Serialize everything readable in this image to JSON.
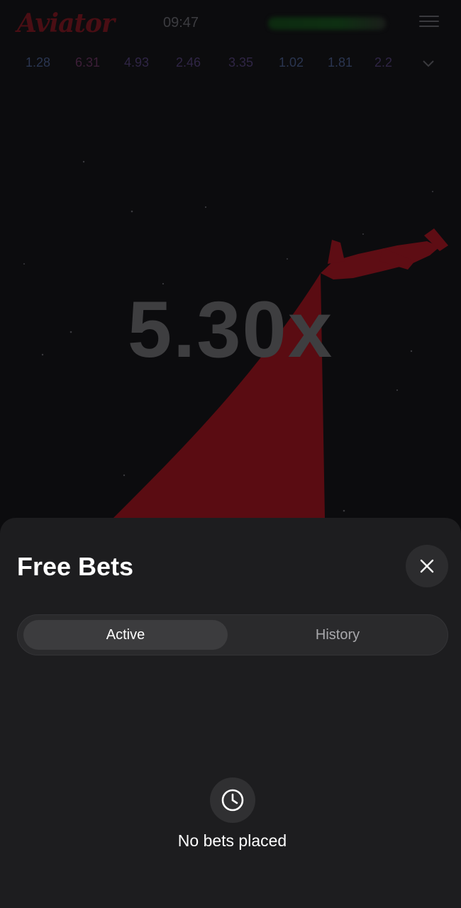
{
  "header": {
    "logo_text": "Aviator",
    "time": "09:47"
  },
  "history": {
    "multipliers": [
      {
        "value": "1.28",
        "color": "#2a3550"
      },
      {
        "value": "6.31",
        "color": "#3d1f38"
      },
      {
        "value": "4.93",
        "color": "#2f2545"
      },
      {
        "value": "2.46",
        "color": "#2f2545"
      },
      {
        "value": "3.35",
        "color": "#2f2545"
      },
      {
        "value": "1.02",
        "color": "#2a3550"
      },
      {
        "value": "1.81",
        "color": "#2a3550"
      },
      {
        "value": "2.2",
        "color": "#2f2545"
      }
    ]
  },
  "game": {
    "multiplier": "5.30x",
    "accent_color": "#5a0c12"
  },
  "free_bets": {
    "title": "Free Bets",
    "tabs": [
      {
        "label": "Active",
        "selected": true
      },
      {
        "label": "History",
        "selected": false
      }
    ],
    "empty_message": "No bets placed",
    "empty_icon": "clock-icon",
    "close_icon": "close-icon"
  }
}
